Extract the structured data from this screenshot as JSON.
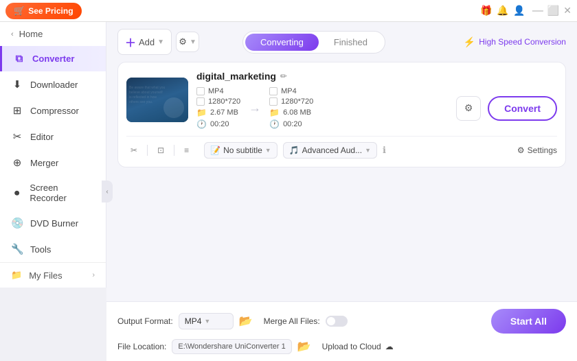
{
  "titlebar": {
    "pricing_btn": "See Pricing",
    "icons": [
      "🎁",
      "🔔",
      "👤"
    ],
    "win_buttons": [
      "minimize",
      "maximize",
      "close"
    ]
  },
  "sidebar": {
    "home_label": "Home",
    "items": [
      {
        "id": "converter",
        "label": "Converter",
        "icon": "⧉",
        "active": true
      },
      {
        "id": "downloader",
        "label": "Downloader",
        "icon": "⬇"
      },
      {
        "id": "compressor",
        "label": "Compressor",
        "icon": "⊞"
      },
      {
        "id": "editor",
        "label": "Editor",
        "icon": "✂"
      },
      {
        "id": "merger",
        "label": "Merger",
        "icon": "⊕"
      },
      {
        "id": "screen-recorder",
        "label": "Screen Recorder",
        "icon": "⏺"
      },
      {
        "id": "dvd-burner",
        "label": "DVD Burner",
        "icon": "💿"
      },
      {
        "id": "tools",
        "label": "Tools",
        "icon": "🔧"
      }
    ],
    "footer": {
      "label": "My Files",
      "icon": "📁"
    }
  },
  "header": {
    "add_btn_label": "Add",
    "settings_btn_label": "⚙",
    "tabs": [
      {
        "id": "converting",
        "label": "Converting",
        "active": true
      },
      {
        "id": "finished",
        "label": "Finished",
        "active": false
      }
    ],
    "speed_label": "High Speed Conversion"
  },
  "file_card": {
    "file_name": "digital_marketing",
    "thumbnail_text": "Be aware that what you\nbelieve about yourself\nis reflected in...",
    "source": {
      "format": "MP4",
      "resolution": "1280*720",
      "size": "2.67 MB",
      "duration": "00:20"
    },
    "target": {
      "format": "MP4",
      "resolution": "1280*720",
      "size": "6.08 MB",
      "duration": "00:20"
    },
    "convert_btn": "Convert",
    "tools": {
      "cut": "✂",
      "crop": "⊡",
      "effects": "≡"
    },
    "subtitle_label": "No subtitle",
    "audio_label": "Advanced Aud...",
    "settings_label": "Settings",
    "info_icon": "ℹ"
  },
  "bottom": {
    "output_format_label": "Output Format:",
    "output_format_value": "MP4",
    "file_location_label": "File Location:",
    "file_location_path": "E:\\Wondershare UniConverter 1",
    "merge_all_label": "Merge All Files:",
    "upload_cloud_label": "Upload to Cloud",
    "start_all_btn": "Start All"
  }
}
